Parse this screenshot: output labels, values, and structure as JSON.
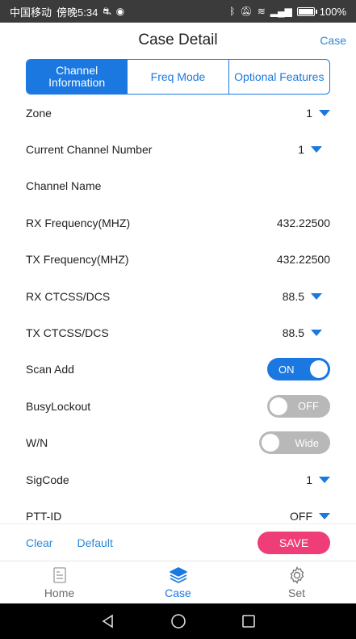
{
  "status_bar": {
    "carrier": "中国移动",
    "time": "傍晚5:34",
    "battery_label": "100%",
    "battery_level": 1.0
  },
  "header": {
    "title": "Case Detail",
    "right_link": "Case"
  },
  "tabs": [
    {
      "label": "Channel Information",
      "active": true
    },
    {
      "label": "Freq Mode",
      "active": false
    },
    {
      "label": "Optional Features",
      "active": false
    }
  ],
  "rows": {
    "zone": {
      "label": "Zone",
      "value": "1"
    },
    "current_channel": {
      "label": "Current Channel Number",
      "value": "1"
    },
    "channel_name": {
      "label": "Channel Name",
      "value": ""
    },
    "rx_freq": {
      "label": "RX Frequency(MHZ)",
      "value": "432.22500"
    },
    "tx_freq": {
      "label": "TX Frequency(MHZ)",
      "value": "432.22500"
    },
    "rx_ctcss": {
      "label": "RX CTCSS/DCS",
      "value": "88.5"
    },
    "tx_ctcss": {
      "label": "TX CTCSS/DCS",
      "value": "88.5"
    },
    "scan_add": {
      "label": "Scan Add",
      "state": "ON"
    },
    "busy_lockout": {
      "label": "BusyLockout",
      "state": "OFF"
    },
    "wn": {
      "label": "W/N",
      "state": "Wide"
    },
    "sigcode": {
      "label": "SigCode",
      "value": "1"
    },
    "ptt_id": {
      "label": "PTT-ID",
      "value": "OFF"
    }
  },
  "actions": {
    "clear": "Clear",
    "default": "Default",
    "save": "SAVE"
  },
  "bottom_nav": [
    {
      "label": "Home",
      "icon": "home-icon",
      "active": false
    },
    {
      "label": "Case",
      "icon": "layers-icon",
      "active": true
    },
    {
      "label": "Set",
      "icon": "gear-icon",
      "active": false
    }
  ],
  "colors": {
    "accent": "#1a78e0",
    "save": "#ef3d78",
    "toggle_off": "#b8b8b8"
  }
}
